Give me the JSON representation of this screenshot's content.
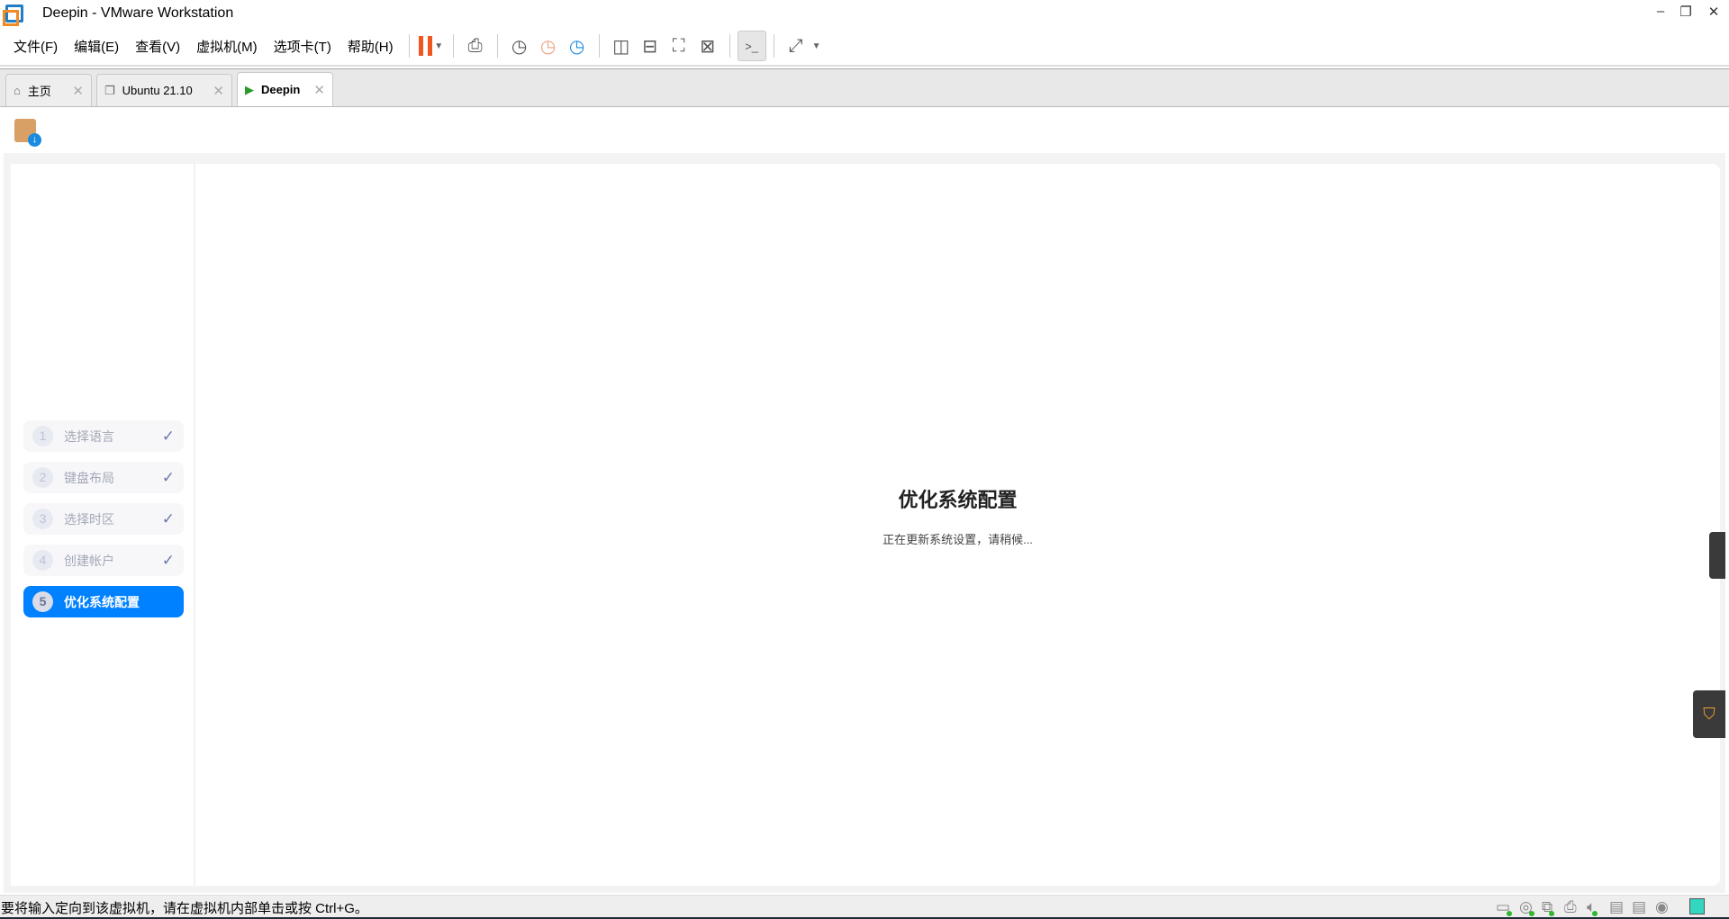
{
  "window": {
    "title": "Deepin - VMware Workstation"
  },
  "menu": [
    "文件(F)",
    "编辑(E)",
    "查看(V)",
    "虚拟机(M)",
    "选项卡(T)",
    "帮助(H)"
  ],
  "tabs": [
    {
      "label": "主页"
    },
    {
      "label": "Ubuntu 21.10"
    },
    {
      "label": "Deepin"
    }
  ],
  "installer": {
    "steps": [
      {
        "num": "1",
        "label": "选择语言",
        "done": true
      },
      {
        "num": "2",
        "label": "键盘布局",
        "done": true
      },
      {
        "num": "3",
        "label": "选择时区",
        "done": true
      },
      {
        "num": "4",
        "label": "创建帐户",
        "done": true
      },
      {
        "num": "5",
        "label": "优化系统配置",
        "done": false
      }
    ],
    "title": "优化系统配置",
    "subtitle": "正在更新系统设置，请稍候..."
  },
  "status": {
    "text": "要将输入定向到该虚拟机，请在虚拟机内部单击或按 Ctrl+G。"
  },
  "colors": {
    "accent": "#0081ff",
    "pause": "#f0561e"
  }
}
